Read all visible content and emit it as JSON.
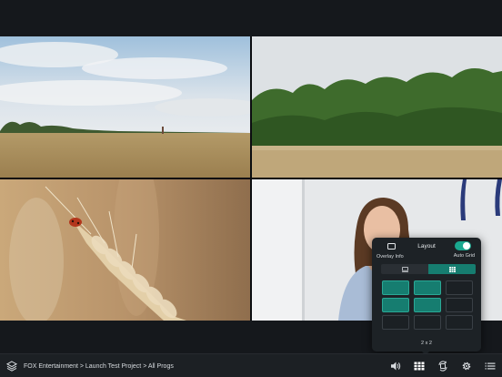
{
  "tiles": [
    {
      "name": "wheat-field-wide"
    },
    {
      "name": "wheat-field-trees"
    },
    {
      "name": "wheat-ear-ladybird"
    },
    {
      "name": "person-on-camera"
    }
  ],
  "bottom_bar": {
    "project_icon": "layers-icon",
    "breadcrumb": "FOX Entertainment > Launch Test Project > All Progs",
    "icons": [
      "volume-icon",
      "grid-icon",
      "rotate-icon",
      "settings-icon",
      "menu-icon"
    ]
  },
  "layout_popover": {
    "overlay_info_label": "Overlay Info",
    "title": "Layout",
    "auto_grid_label": "Auto Grid",
    "auto_grid_on": true,
    "modes": [
      "single-screen-icon",
      "grid-icon"
    ],
    "active_mode": "grid-icon",
    "cells": [
      true,
      true,
      false,
      true,
      true,
      false,
      false,
      false,
      false
    ],
    "size_label": "2 x 2"
  },
  "colors": {
    "accent": "#167d70",
    "toggle_on": "#1aa88f",
    "background": "#15181c"
  }
}
